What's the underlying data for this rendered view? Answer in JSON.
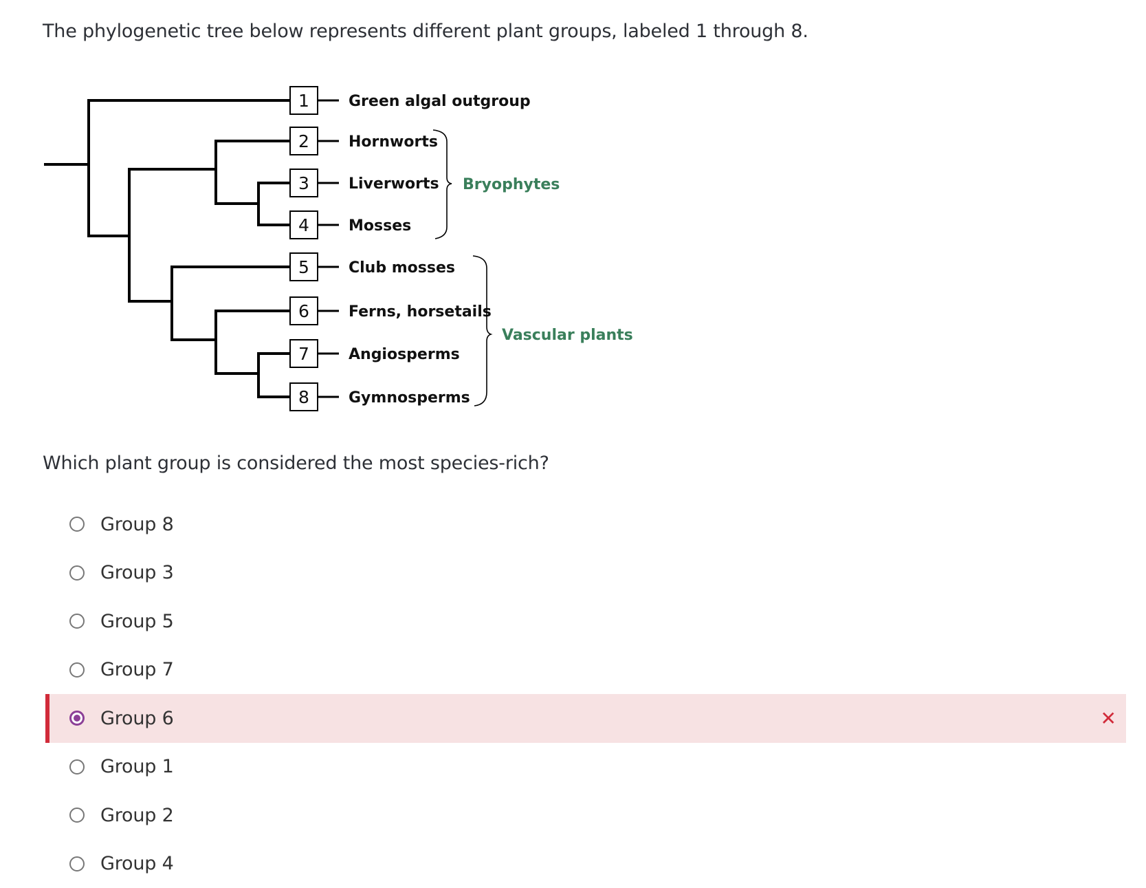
{
  "intro_text": "The phylogenetic tree below represents different plant groups, labeled 1 through 8.",
  "tree": {
    "leaves": [
      {
        "number": "1",
        "label": "Green algal outgroup"
      },
      {
        "number": "2",
        "label": "Hornworts"
      },
      {
        "number": "3",
        "label": "Liverworts"
      },
      {
        "number": "4",
        "label": "Mosses"
      },
      {
        "number": "5",
        "label": "Club mosses"
      },
      {
        "number": "6",
        "label": "Ferns, horsetails"
      },
      {
        "number": "7",
        "label": "Angiosperms"
      },
      {
        "number": "8",
        "label": "Gymnosperms"
      }
    ],
    "brackets": [
      {
        "label": "Bryophytes",
        "leaves": [
          "2",
          "3",
          "4"
        ]
      },
      {
        "label": "Vascular plants",
        "leaves": [
          "5",
          "6",
          "7",
          "8"
        ]
      }
    ],
    "group_label_color": "#3a7f5b"
  },
  "question_text": "Which plant group is considered the most species-rich?",
  "options": [
    {
      "label": "Group 8",
      "selected": false
    },
    {
      "label": "Group 3",
      "selected": false
    },
    {
      "label": "Group 5",
      "selected": false
    },
    {
      "label": "Group 7",
      "selected": false
    },
    {
      "label": "Group 6",
      "selected": true,
      "feedback": "✕"
    },
    {
      "label": "Group 1",
      "selected": false
    },
    {
      "label": "Group 2",
      "selected": false
    },
    {
      "label": "Group 4",
      "selected": false
    }
  ],
  "colors": {
    "incorrect": "#d12b3a",
    "incorrect_bg": "#f7e2e3",
    "radio_selected": "#8c3f97"
  }
}
